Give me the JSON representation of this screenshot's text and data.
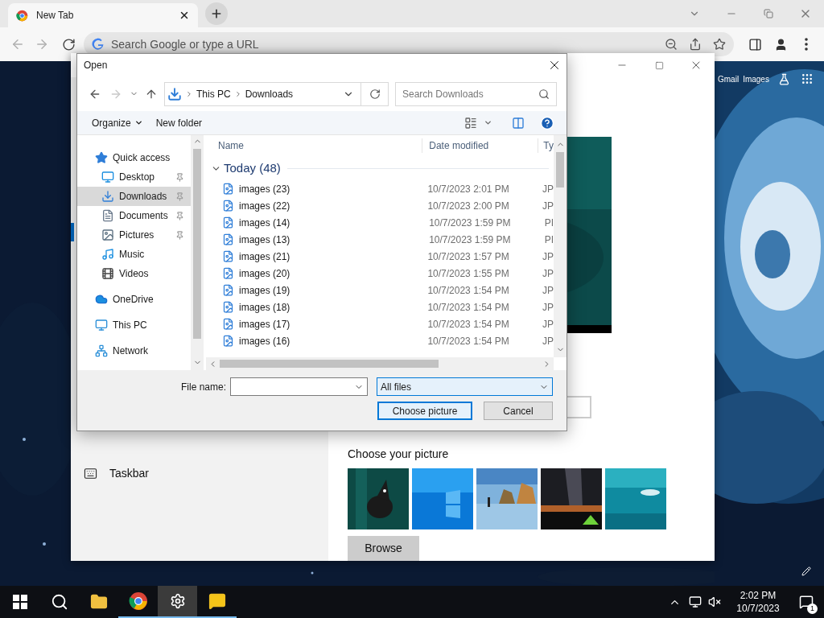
{
  "browser": {
    "tab": {
      "title": "New Tab",
      "selected": true
    },
    "omnibox": {
      "placeholder": "Search Google or type a URL"
    },
    "ntp_links": [
      "Gmail",
      "Images"
    ]
  },
  "settings": {
    "nav_items": [
      {
        "label": "Taskbar",
        "selected": false
      }
    ],
    "picture_section": {
      "title": "Choose your picture",
      "browse": "Browse"
    }
  },
  "dialog": {
    "title": "Open",
    "path": [
      "This PC",
      "Downloads"
    ],
    "search": {
      "placeholder": "Search Downloads"
    },
    "toolbar": [
      "Organize",
      "New folder"
    ],
    "nav": [
      {
        "label": "Quick access",
        "kind": "quick",
        "selected": false,
        "children": [
          {
            "label": "Desktop",
            "kind": "desktop",
            "pinned": true,
            "selected": false
          },
          {
            "label": "Downloads",
            "kind": "downloads",
            "pinned": true,
            "selected": true
          },
          {
            "label": "Documents",
            "kind": "documents",
            "pinned": true,
            "selected": false
          },
          {
            "label": "Pictures",
            "kind": "pictures",
            "pinned": true,
            "selected": false
          },
          {
            "label": "Music",
            "kind": "music",
            "pinned": false,
            "selected": false
          },
          {
            "label": "Videos",
            "kind": "videos",
            "pinned": false,
            "selected": false
          }
        ]
      },
      {
        "label": "OneDrive",
        "kind": "cloud",
        "selected": false
      },
      {
        "label": "This PC",
        "kind": "pc",
        "selected": false
      },
      {
        "label": "Network",
        "kind": "network",
        "selected": false
      }
    ],
    "columns": [
      "Name",
      "Date modified",
      "Ty"
    ],
    "group": {
      "label": "Today (48)",
      "expanded": true
    },
    "files": [
      {
        "name": "images (23)",
        "date": "10/7/2023 2:01 PM",
        "type": "JP"
      },
      {
        "name": "images (22)",
        "date": "10/7/2023 2:00 PM",
        "type": "JP"
      },
      {
        "name": "images (14)",
        "date": "10/7/2023 1:59 PM",
        "type": "PI"
      },
      {
        "name": "images (13)",
        "date": "10/7/2023 1:59 PM",
        "type": "PI"
      },
      {
        "name": "images (21)",
        "date": "10/7/2023 1:57 PM",
        "type": "JP"
      },
      {
        "name": "images (20)",
        "date": "10/7/2023 1:55 PM",
        "type": "JP"
      },
      {
        "name": "images (19)",
        "date": "10/7/2023 1:54 PM",
        "type": "JP"
      },
      {
        "name": "images (18)",
        "date": "10/7/2023 1:54 PM",
        "type": "JP"
      },
      {
        "name": "images (17)",
        "date": "10/7/2023 1:54 PM",
        "type": "JP"
      },
      {
        "name": "images (16)",
        "date": "10/7/2023 1:54 PM",
        "type": "JP"
      }
    ],
    "file_name_label": "File name:",
    "file_type": "All files",
    "buttons": [
      {
        "label": "Choose picture",
        "kind": "primary"
      },
      {
        "label": "Cancel",
        "kind": "normal"
      }
    ]
  },
  "taskbar": {
    "apps": [
      {
        "kind": "start",
        "running": false,
        "selected": false
      },
      {
        "kind": "search",
        "running": false,
        "selected": false
      },
      {
        "kind": "explorer",
        "running": false,
        "selected": false
      },
      {
        "kind": "chrome",
        "running": true,
        "selected": false
      },
      {
        "kind": "settings",
        "running": true,
        "selected": true
      },
      {
        "kind": "chat",
        "running": true,
        "selected": false
      }
    ],
    "clock": {
      "time": "2:02 PM",
      "date": "10/7/2023"
    },
    "notification_count": "1"
  }
}
